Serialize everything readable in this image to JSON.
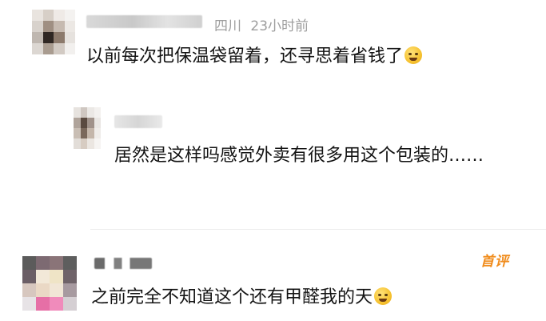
{
  "comment1": {
    "location": "四川",
    "time": "23小时前",
    "text": "以前每次把保温袋留着，还寻思着省钱了",
    "emoji_name": "laughing-crying-emoji"
  },
  "reply1": {
    "text": "居然是这样吗感觉外卖有很多用这个包装的……"
  },
  "comment2": {
    "badge": "首评",
    "text": "之前完全不知道这个还有甲醛我的天",
    "emoji_name": "fearful-emoji"
  },
  "colors": {
    "meta_gray": "#9e9e9e",
    "badge_orange": "#f08c1c",
    "text_dark": "#141414"
  }
}
